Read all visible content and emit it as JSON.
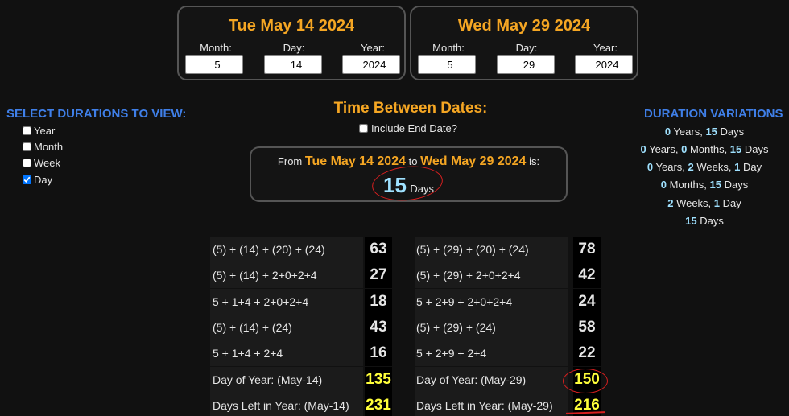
{
  "start": {
    "title": "Tue May 14 2024",
    "month_label": "Month:",
    "day_label": "Day:",
    "year_label": "Year:",
    "month": "5",
    "day": "14",
    "year": "2024"
  },
  "end": {
    "title": "Wed May 29 2024",
    "month_label": "Month:",
    "day_label": "Day:",
    "year_label": "Year:",
    "month": "5",
    "day": "29",
    "year": "2024"
  },
  "select": {
    "heading": "SELECT DURATIONS TO VIEW:",
    "options": [
      {
        "label": "Year",
        "checked": false
      },
      {
        "label": "Month",
        "checked": false
      },
      {
        "label": "Week",
        "checked": false
      },
      {
        "label": "Day",
        "checked": true
      }
    ]
  },
  "between": {
    "title": "Time Between Dates:",
    "include_label": "Include End Date?",
    "from_text": "From",
    "from_date": "Tue May 14 2024",
    "to_text": "to",
    "to_date": "Wed May 29 2024",
    "is_text": "is:",
    "count": "15",
    "unit": "Days"
  },
  "variations": {
    "heading": "DURATION VARIATIONS",
    "rows": [
      [
        {
          "n": "0"
        },
        {
          "t": " Years, "
        },
        {
          "n": "15"
        },
        {
          "t": " Days"
        }
      ],
      [
        {
          "n": "0"
        },
        {
          "t": " Years, "
        },
        {
          "n": "0"
        },
        {
          "t": " Months, "
        },
        {
          "n": "15"
        },
        {
          "t": " Days"
        }
      ],
      [
        {
          "n": "0"
        },
        {
          "t": " Years, "
        },
        {
          "n": "2"
        },
        {
          "t": " Weeks, "
        },
        {
          "n": "1"
        },
        {
          "t": " Day"
        }
      ],
      [
        {
          "n": "0"
        },
        {
          "t": " Months, "
        },
        {
          "n": "15"
        },
        {
          "t": " Days"
        }
      ],
      [
        {
          "n": "2"
        },
        {
          "t": " Weeks, "
        },
        {
          "n": "1"
        },
        {
          "t": " Day"
        }
      ],
      [
        {
          "n": "15"
        },
        {
          "t": " Days"
        }
      ]
    ]
  },
  "numerology": {
    "left": [
      {
        "label": "(5) + (14) + (20) + (24)",
        "value": "63"
      },
      {
        "label": "(5) + (14) + 2+0+2+4",
        "value": "27"
      },
      {
        "label": "5 + 1+4 + 2+0+2+4",
        "value": "18"
      },
      {
        "label": "(5) + (14) + (24)",
        "value": "43"
      },
      {
        "label": "5 + 1+4 + 2+4",
        "value": "16"
      },
      {
        "label": "Day of Year: (May-14)",
        "value": "135"
      },
      {
        "label": "Days Left in Year: (May-14)",
        "value": "231"
      }
    ],
    "right": [
      {
        "label": "(5) + (29) + (20) + (24)",
        "value": "78"
      },
      {
        "label": "(5) + (29) + 2+0+2+4",
        "value": "42"
      },
      {
        "label": "5 + 2+9 + 2+0+2+4",
        "value": "24"
      },
      {
        "label": "(5) + (29) + (24)",
        "value": "58"
      },
      {
        "label": "5 + 2+9 + 2+4",
        "value": "22"
      },
      {
        "label": "Day of Year: (May-29)",
        "value": "150"
      },
      {
        "label": "Days Left in Year: (May-29)",
        "value": "216"
      }
    ]
  },
  "colors": {
    "accent_orange": "#f5a623",
    "heading_blue": "#3f7fe8",
    "highlight_cyan": "#9fe1ff",
    "highlight_yellow": "#ffff3a",
    "annotation_red": "#d71f1f"
  }
}
